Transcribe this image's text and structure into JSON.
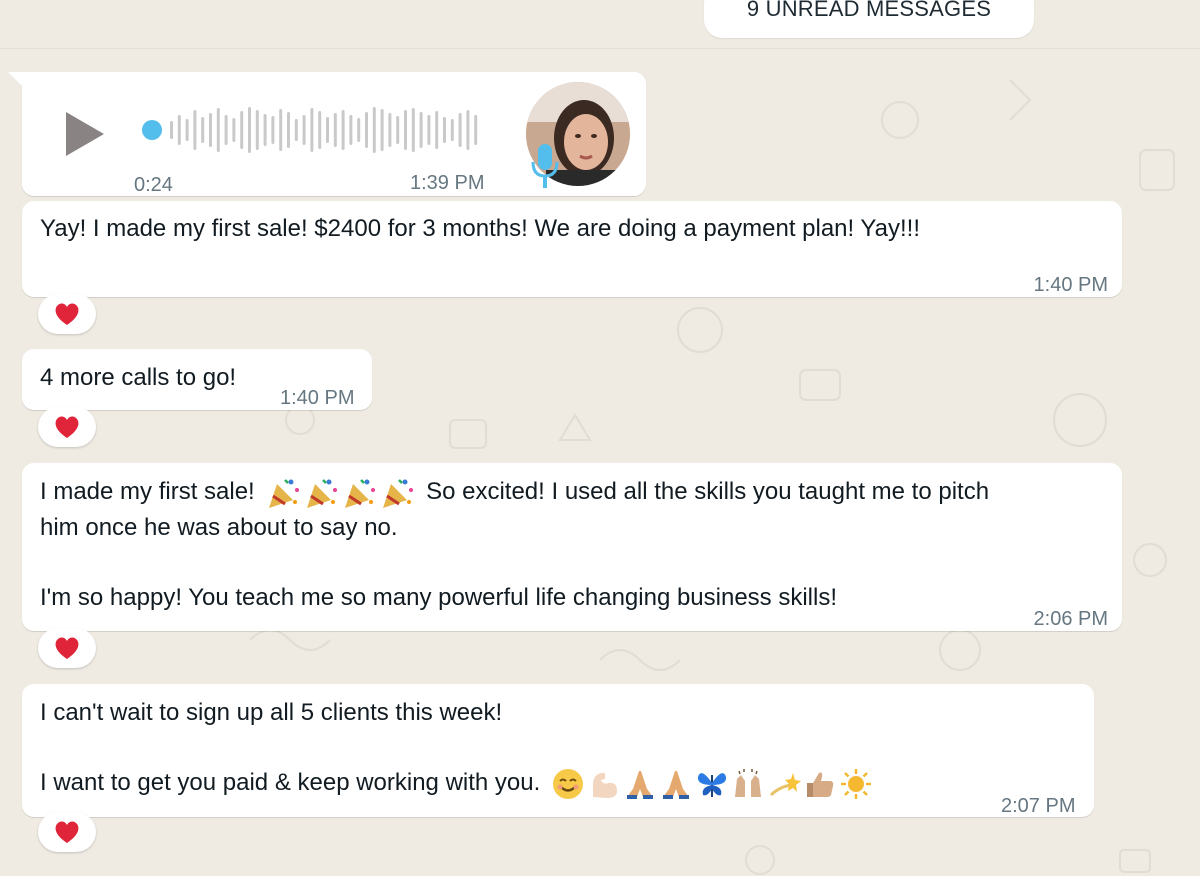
{
  "unread_banner": {
    "label": "9 UNREAD MESSAGES"
  },
  "voice_message": {
    "duration": "0:24",
    "time": "1:39 PM"
  },
  "messages": [
    {
      "lines": [
        "Yay! I made my first sale! $2400 for 3 months! We are doing a payment plan! Yay!!!"
      ],
      "time": "1:40 PM",
      "reaction": "red-heart"
    },
    {
      "lines": [
        "4 more calls to go!"
      ],
      "time": "1:40 PM",
      "reaction": "red-heart"
    },
    {
      "line1_start": "I made my first sale!",
      "line1_emojis": [
        "party-popper",
        "party-popper",
        "party-popper",
        "party-popper"
      ],
      "line1_end": "So excited! I used all the skills you taught me to pitch",
      "line2": "him once he was about to say no.",
      "line3": "I'm so happy! You teach me so many powerful life changing business skills!",
      "time": "2:06 PM",
      "reaction": "red-heart"
    },
    {
      "line1": "I can't wait to sign up all 5 clients this week!",
      "line2": "I want to get you paid & keep working with you.",
      "line2_emojis": [
        "smiling-face",
        "flexed-biceps",
        "folded-hands",
        "folded-hands",
        "butterfly",
        "raising-hands",
        "dizzy",
        "thumbs-up",
        "sun"
      ],
      "time": "2:07 PM",
      "reaction": "red-heart"
    }
  ],
  "colors": {
    "background": "#efeae2",
    "bubble": "#ffffff",
    "timestamp": "#667781",
    "accent_blue": "#53bdeb",
    "heart": "#e0243a"
  }
}
